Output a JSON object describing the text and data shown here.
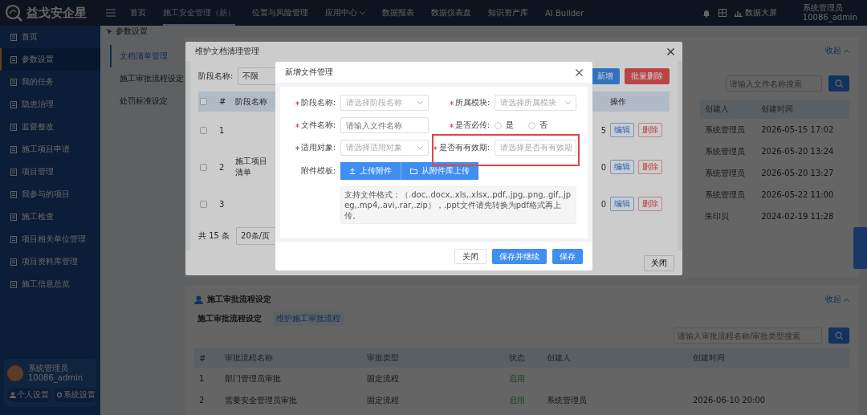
{
  "topbar": {
    "logo": "益戈安企星",
    "nav": [
      {
        "label": "首页",
        "kind": "link",
        "selected": false
      },
      {
        "label": "施工安全管理（新）",
        "kind": "link",
        "selected": true
      },
      {
        "label": "位置与风险管理",
        "kind": "link",
        "selected": false
      },
      {
        "label": "应用中心",
        "kind": "menu",
        "selected": false
      },
      {
        "label": "数据报表",
        "kind": "link",
        "selected": false
      },
      {
        "label": "数据仪表盘",
        "kind": "link",
        "selected": false
      },
      {
        "label": "知识资产库",
        "kind": "link",
        "selected": false
      },
      {
        "label": "AI Builder",
        "kind": "link",
        "selected": false
      }
    ],
    "screen_button": "数据大屏",
    "user": {
      "name": "系统管理员",
      "account": "10086_admin"
    }
  },
  "sidebar": {
    "items": [
      {
        "label": "首页",
        "selected": false
      },
      {
        "label": "参数设置",
        "selected": true
      },
      {
        "label": "我的任务",
        "selected": false
      },
      {
        "label": "隐患治理",
        "selected": false
      },
      {
        "label": "监督整改",
        "selected": false
      },
      {
        "label": "施工项目申请",
        "selected": false
      },
      {
        "label": "项目管理",
        "selected": false
      },
      {
        "label": "我参与的项目",
        "selected": false
      },
      {
        "label": "施工检查",
        "selected": false
      },
      {
        "label": "项目相关单位管理",
        "selected": false
      },
      {
        "label": "项目资料库管理",
        "selected": false
      },
      {
        "label": "施工信息总览",
        "selected": false
      }
    ],
    "user": {
      "name": "系统管理员",
      "account": "10086_admin"
    },
    "buttons": [
      "个人设置",
      "系统设置"
    ]
  },
  "breadcrumb": "参数设置",
  "submenu": [
    {
      "label": "文档清单管理",
      "selected": true
    },
    {
      "label": "施工审批流程设定",
      "selected": false
    },
    {
      "label": "处罚标准设定",
      "selected": false
    }
  ],
  "document_list": {
    "collapse": "收起",
    "search_placeholder": "请输入文件名称搜索",
    "columns": [
      "创建人",
      "创建时间"
    ],
    "rows": [
      [
        "系统管理员",
        "2026-05-15 17:02"
      ],
      [
        "系统管理员",
        "2026-05-20 13:24"
      ],
      [
        "系统管理员",
        "2026-05-20 13:27"
      ],
      [
        "系统管理员",
        "2026-05-22 11:00"
      ],
      [
        "朱印贝",
        "2024-02-19 11:28"
      ]
    ]
  },
  "approval_section": {
    "title": "施工审批流程设定",
    "collapse": "收起",
    "tabs": [
      {
        "label": "施工审批流程设定",
        "selected": true
      },
      {
        "label": "维护施工审批流程",
        "selected": false
      }
    ],
    "search_placeholder": "请输入审批流程名称/审批类型搜索",
    "columns": [
      "#",
      "审批流程名称",
      "审批类型",
      "状态",
      "创建人",
      "创建时间"
    ],
    "rows": [
      [
        "1",
        "部门管理员审批",
        "固定流程",
        "启用"
      ],
      [
        "2",
        "需要安全管理员审批",
        "固定流程",
        "启用",
        "系统管理员",
        "2026-06-10 20:00"
      ]
    ]
  },
  "stage_modal": {
    "title": "维护文档清理管理",
    "filter_label": "阶段名称:",
    "filter_value": "不限",
    "buttons": [
      {
        "label": "新增",
        "kind": "primary"
      },
      {
        "label": "批量删除",
        "kind": "danger"
      }
    ],
    "all_checked": false,
    "columns": {
      "index": "#",
      "stage": "阶段名称",
      "actions": "操作"
    },
    "rows": [
      {
        "checked": false,
        "index": "1",
        "column_4": "5",
        "actions": [
          "编辑",
          "删除"
        ]
      },
      {
        "checked": false,
        "index": "2",
        "stage": "施工项目清单",
        "column_4": "0",
        "actions": [
          "编辑",
          "删除"
        ]
      },
      {
        "checked": false,
        "index": "3",
        "column_4": "0",
        "actions": [
          "编辑",
          "删除"
        ]
      }
    ],
    "total": "共 15 条",
    "page_size": "20条/页",
    "close": "关闭"
  },
  "file_dialog": {
    "title": "新增文件管理",
    "fields": [
      {
        "kind": "select",
        "label": "阶段名称:",
        "required": true,
        "placeholder": "请选择阶段名称"
      },
      {
        "kind": "select",
        "label": "所属模块:",
        "required": true,
        "placeholder": "请选择所属模块"
      },
      {
        "kind": "input",
        "label": "文件名称:",
        "required": true,
        "placeholder": "请输入文件名称"
      },
      {
        "kind": "radio",
        "label": "是否必传:",
        "required": true,
        "options": [
          {
            "label": "是",
            "selected": false
          },
          {
            "label": "否",
            "selected": false
          }
        ]
      },
      {
        "kind": "select",
        "label": "适用对象:",
        "required": true,
        "placeholder": "请选择适用对象"
      },
      {
        "kind": "select",
        "label": "是否有有效期:",
        "required": true,
        "placeholder": "请选择是否有有效期",
        "highlighted": true
      }
    ],
    "attachment": {
      "label": "附件模板:",
      "buttons": [
        {
          "label": "上传附件",
          "kind": "upload"
        },
        {
          "label": "从附件库上传",
          "kind": "library"
        }
      ],
      "hint": "支持文件格式：（.doc,.docx,.xls,.xlsx,.pdf,.jpg,.png,.gif,.jpeg,.mp4,.avi,.rar,.zip），.ppt文件请先转换为pdf格式再上传。"
    },
    "buttons": [
      {
        "label": "关闭",
        "kind": "default"
      },
      {
        "label": "保存并继续",
        "kind": "primary"
      },
      {
        "label": "保存",
        "kind": "primary"
      }
    ]
  }
}
